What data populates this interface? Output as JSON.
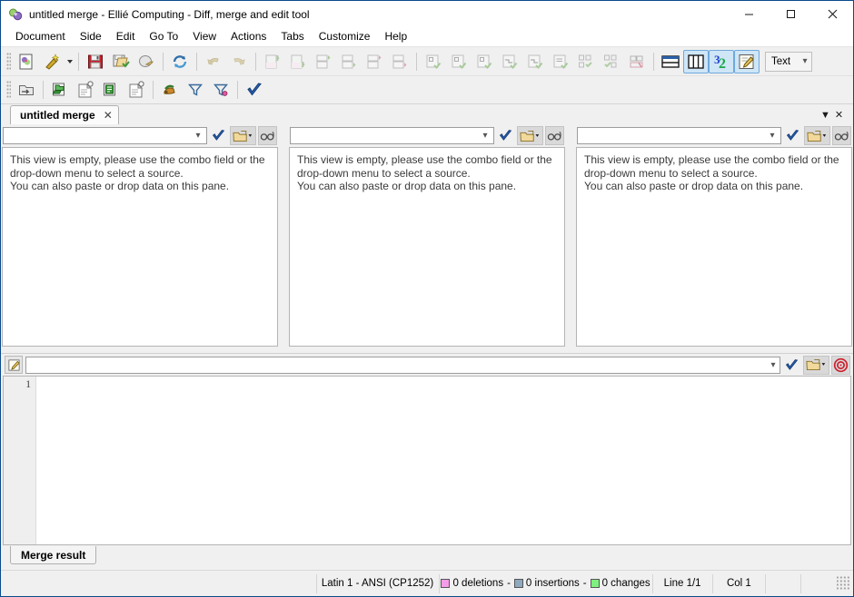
{
  "window": {
    "title": "untitled merge - Ellié Computing - Diff, merge and edit tool",
    "app_icon": "app-logo-icon",
    "minimize_label": "—",
    "maximize_label": "□",
    "close_label": "✕"
  },
  "menubar": {
    "items": [
      {
        "label": "Document"
      },
      {
        "label": "Side"
      },
      {
        "label": "Edit"
      },
      {
        "label": "Go To"
      },
      {
        "label": "View"
      },
      {
        "label": "Actions"
      },
      {
        "label": "Tabs"
      },
      {
        "label": "Customize"
      },
      {
        "label": "Help"
      }
    ]
  },
  "toolbar_main": {
    "buttons": [
      {
        "name": "new-document-icon",
        "active": false
      },
      {
        "name": "magic-wand-icon",
        "active": false
      },
      {
        "name": "save-icon",
        "active": false
      },
      {
        "name": "save-as-icon",
        "active": false
      },
      {
        "name": "save-all-icon",
        "active": false
      },
      {
        "name": "refresh-compare-icon",
        "active": false
      },
      {
        "name": "undo-icon",
        "active": false
      },
      {
        "name": "redo-icon",
        "active": false
      },
      {
        "name": "first-difference-icon",
        "active": false
      },
      {
        "name": "previous-difference-icon",
        "active": false
      },
      {
        "name": "next-difference-block-icon",
        "active": false
      },
      {
        "name": "next-difference-icon",
        "active": false
      },
      {
        "name": "last-difference-icon",
        "active": false
      },
      {
        "name": "goto-difference-icon",
        "active": false
      },
      {
        "name": "copy-left-icon",
        "active": false
      },
      {
        "name": "copy-left-block-icon",
        "active": false
      },
      {
        "name": "copy-right-icon",
        "active": false
      },
      {
        "name": "merge-left-icon",
        "active": false
      },
      {
        "name": "merge-right-icon",
        "active": false
      },
      {
        "name": "merge-result-icon",
        "active": false
      },
      {
        "name": "resolve-conflict-left-icon",
        "active": false
      },
      {
        "name": "resolve-conflict-right-icon",
        "active": false
      },
      {
        "name": "conflict-marker-icon",
        "active": false
      },
      {
        "name": "horizontal-layout-icon",
        "active": false
      },
      {
        "name": "vertical-layout-icon",
        "active": true
      },
      {
        "name": "three-way-merge-icon",
        "active": true
      },
      {
        "name": "edit-mode-icon",
        "active": true
      }
    ],
    "mode_combo": {
      "value": "Text",
      "name": "document-type-combo"
    }
  },
  "toolbar_secondary": {
    "buttons": [
      {
        "name": "open-folder-icon"
      },
      {
        "name": "compare-folders-icon"
      },
      {
        "name": "new-compare-session-icon"
      },
      {
        "name": "compare-files-icon"
      },
      {
        "name": "new-file-session-icon"
      },
      {
        "name": "ignore-rules-icon"
      },
      {
        "name": "filter-icon"
      },
      {
        "name": "clear-filter-icon"
      },
      {
        "name": "apply-check-icon"
      }
    ]
  },
  "tabstrip": {
    "tabs": [
      {
        "label": "untitled merge",
        "close": "✕",
        "active": true
      }
    ],
    "list_icon": "tab-list-dropdown-icon",
    "close_icon": "close-tab-icon",
    "list_glyph": "▼",
    "close_glyph": "✕"
  },
  "panes": [
    {
      "name": "left-pane",
      "combo_value": "",
      "combo_placeholder": "",
      "message_lines": [
        "This view is empty, please use the combo field or the",
        "drop-down menu to select a source.",
        "You can also paste or drop data on this pane."
      ],
      "buttons": [
        {
          "name": "validate-check-icon"
        },
        {
          "name": "open-source-dropdown-icon"
        },
        {
          "name": "preview-glasses-icon"
        }
      ]
    },
    {
      "name": "middle-pane",
      "combo_value": "",
      "combo_placeholder": "",
      "message_lines": [
        "This view is empty, please use the combo field or the",
        "drop-down menu to select a source.",
        "You can also paste or drop data on this pane."
      ],
      "buttons": [
        {
          "name": "validate-check-icon"
        },
        {
          "name": "open-source-dropdown-icon"
        },
        {
          "name": "preview-glasses-icon"
        }
      ]
    },
    {
      "name": "right-pane",
      "combo_value": "",
      "combo_placeholder": "",
      "message_lines": [
        "This view is empty, please use the combo field or the",
        "drop-down menu to select a source.",
        "You can also paste or drop data on this pane."
      ],
      "buttons": [
        {
          "name": "validate-check-icon"
        },
        {
          "name": "open-source-dropdown-icon"
        },
        {
          "name": "preview-glasses-icon"
        }
      ]
    }
  ],
  "merge_result": {
    "edit_icon": "edit-pencil-icon",
    "combo_value": "",
    "buttons": [
      {
        "name": "validate-check-icon"
      },
      {
        "name": "open-target-dropdown-icon"
      },
      {
        "name": "record-target-icon"
      }
    ],
    "editor": {
      "line_numbers": [
        "1"
      ],
      "content": ""
    },
    "tab_label": "Merge result"
  },
  "statusbar": {
    "encoding": "Latin 1 - ANSI (CP1252)",
    "deletions": "0 deletions",
    "insertions": "0 insertions",
    "changes": "0 changes",
    "separator": "-",
    "line": "Line 1/1",
    "column": "Col 1",
    "colors": {
      "deletions": "#f49ce8",
      "insertions": "#8fa9bf",
      "changes": "#7ff07f"
    }
  }
}
